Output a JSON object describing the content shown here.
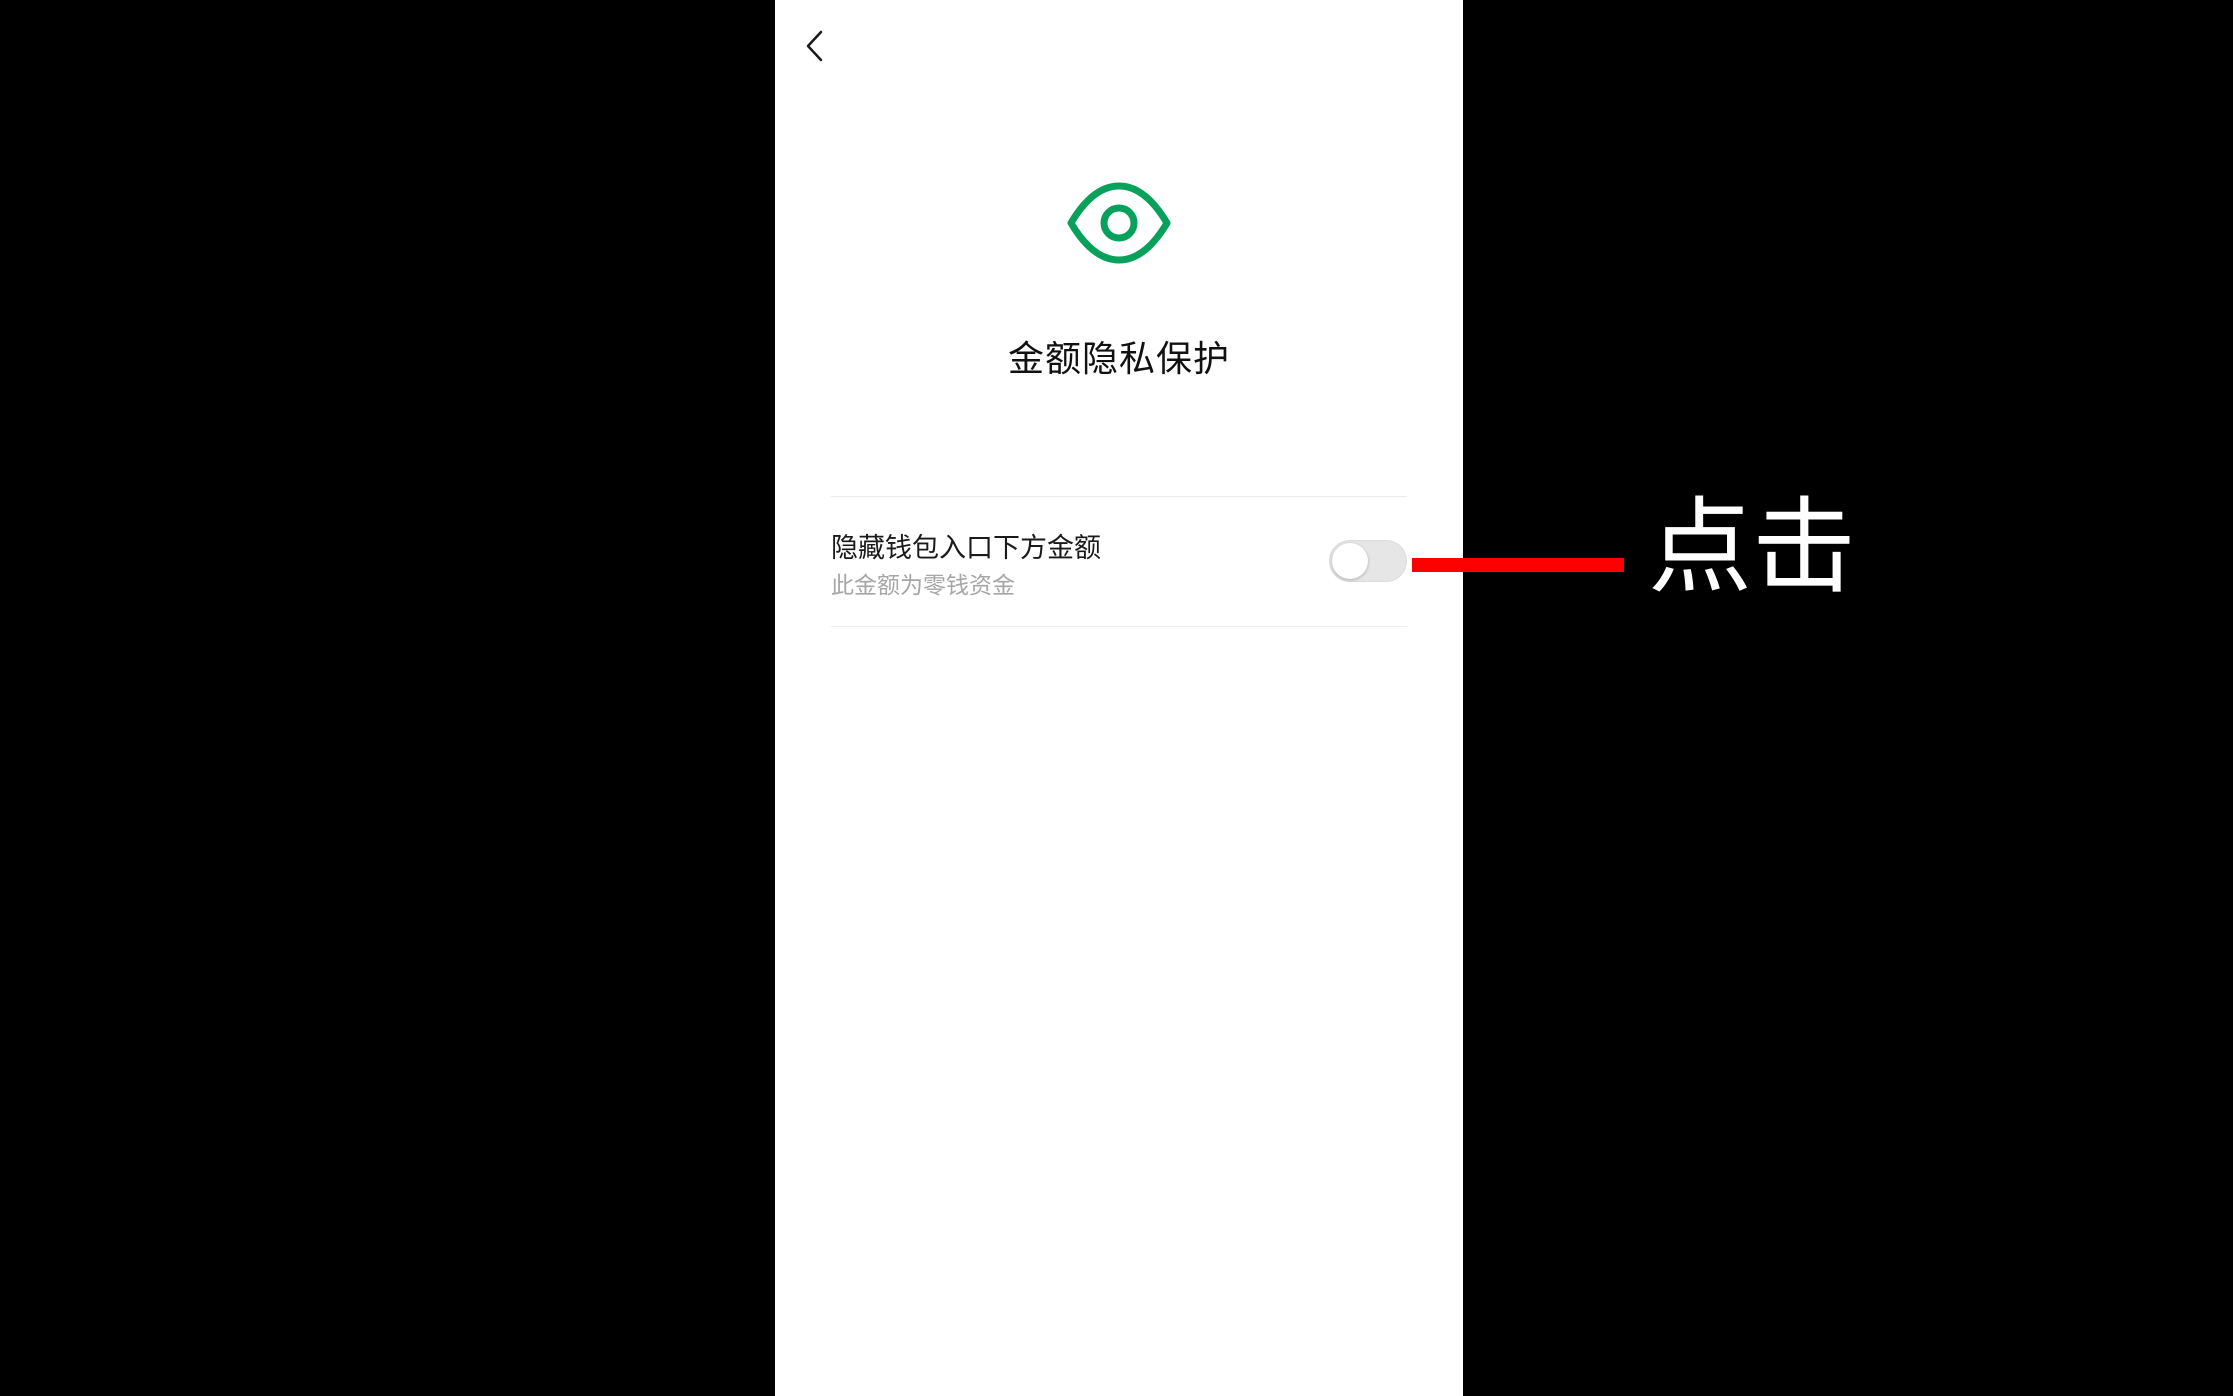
{
  "screen": {
    "title": "金额隐私保护",
    "back_icon": "chevron-left-icon",
    "header_icon": "eye-icon",
    "accent_color": "#07A15C"
  },
  "setting": {
    "label": "隐藏钱包入口下方金额",
    "description": "此金额为零钱资金",
    "toggle_on": false
  },
  "annotation": {
    "text": "点击",
    "line_color": "#FF0000"
  }
}
